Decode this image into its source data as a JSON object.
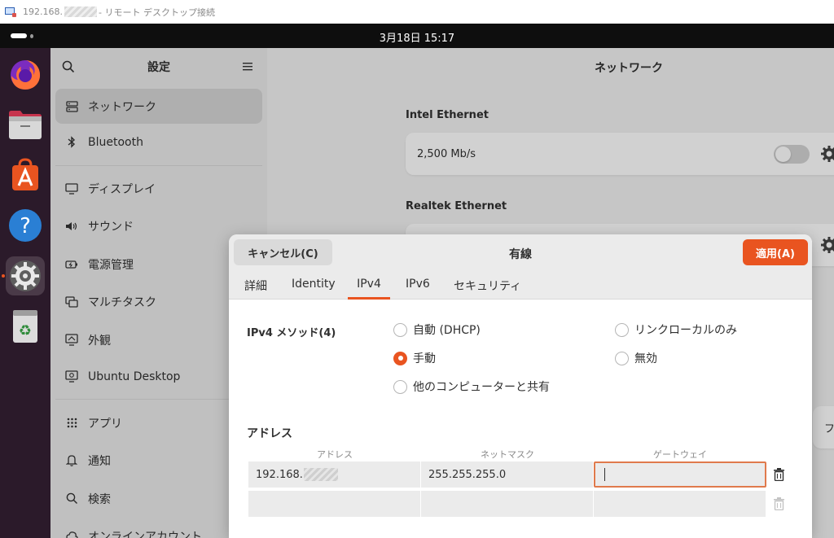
{
  "rdp": {
    "ip_prefix": "192.168.",
    "title": "- リモート デスクトップ接続"
  },
  "topbar": {
    "clock": "3月18日  15:17"
  },
  "dock": {
    "items": [
      {
        "name": "firefox-icon"
      },
      {
        "name": "files-icon"
      },
      {
        "name": "app-center-icon"
      },
      {
        "name": "help-icon"
      },
      {
        "name": "settings-icon"
      },
      {
        "name": "trash-icon"
      }
    ]
  },
  "sidebar": {
    "title": "設定",
    "items": [
      {
        "label": "ネットワーク",
        "icon": "network-icon"
      },
      {
        "label": "Bluetooth",
        "icon": "bluetooth-icon"
      },
      {
        "label": "ディスプレイ",
        "icon": "display-icon"
      },
      {
        "label": "サウンド",
        "icon": "sound-icon"
      },
      {
        "label": "電源管理",
        "icon": "power-icon"
      },
      {
        "label": "マルチタスク",
        "icon": "multitasking-icon"
      },
      {
        "label": "外観",
        "icon": "appearance-icon"
      },
      {
        "label": "Ubuntu Desktop",
        "icon": "ubuntu-desktop-icon"
      },
      {
        "label": "アプリ",
        "icon": "apps-icon"
      },
      {
        "label": "通知",
        "icon": "bell-icon"
      },
      {
        "label": "検索",
        "icon": "search-icon"
      },
      {
        "label": "オンラインアカウント",
        "icon": "online-accounts-icon"
      }
    ]
  },
  "network": {
    "title": "ネットワーク",
    "intel": {
      "label": "Intel Ethernet",
      "speed": "2,500 Mb/s"
    },
    "realtek": {
      "label": "Realtek Ethernet"
    },
    "partial_text": "フ"
  },
  "dialog": {
    "cancel_label": "キャンセル(C)",
    "title": "有線",
    "apply_label": "適用(A)",
    "tabs": [
      "詳細",
      "Identity",
      "IPv4",
      "IPv6",
      "セキュリティ"
    ],
    "active_tab": "IPv4",
    "method_label": "IPv4 メソッド(4)",
    "methods": {
      "auto": "自動 (DHCP)",
      "link_local": "リンクローカルのみ",
      "manual": "手動",
      "disabled": "無効",
      "shared": "他のコンピューターと共有"
    },
    "selected_method": "manual",
    "address_section": "アドレス",
    "columns": {
      "address": "アドレス",
      "netmask": "ネットマスク",
      "gateway": "ゲートウェイ"
    },
    "rows": [
      {
        "address": "192.168.",
        "netmask": "255.255.255.0",
        "gateway": ""
      },
      {
        "address": "",
        "netmask": "",
        "gateway": ""
      }
    ]
  },
  "colors": {
    "accent": "#e95420",
    "dock_bg": "#2b1a2a",
    "topbar_bg": "#0e0e0e"
  }
}
